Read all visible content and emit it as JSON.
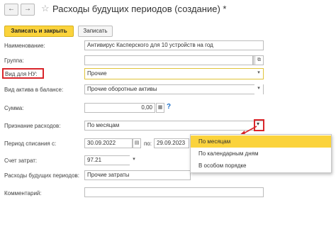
{
  "window": {
    "title": "Расходы будущих периодов (создание)",
    "title_star": "*",
    "back_icon": "←",
    "forward_icon": "→",
    "star_icon": "☆"
  },
  "toolbar": {
    "save_close_label": "Записать и закрыть",
    "save_label": "Записать"
  },
  "form": {
    "name_label": "Наименование:",
    "name_value": "Антивирус Касперского для 10 устройств на год",
    "group_label": "Группа:",
    "group_value": "",
    "nu_label": "Вид для НУ:",
    "nu_value": "Прочие",
    "asset_label": "Вид актива в балансе:",
    "asset_value": "Прочие оборотные активы",
    "sum_label": "Сумма:",
    "sum_value": "0,00",
    "sum_help": "?",
    "recognition_label": "Признание расходов:",
    "recognition_value": "По месяцам",
    "period_label": "Период списания с:",
    "period_from": "30.09.2022",
    "period_to_label": "по:",
    "period_to": "29.09.2023",
    "account_label": "Счет затрат:",
    "account_value": "97.21",
    "future_label": "Расходы будущих периодов:",
    "future_value": "Прочие затраты",
    "comment_label": "Комментарий:",
    "comment_value": ""
  },
  "dropdown": {
    "options": [
      "По месяцам",
      "По календарным дням",
      "В особом порядке"
    ],
    "selected": "По месяцам"
  },
  "colors": {
    "accent_yellow": "#fbd33c",
    "highlight_red": "#d9262b",
    "help_blue": "#1a6ec8"
  }
}
